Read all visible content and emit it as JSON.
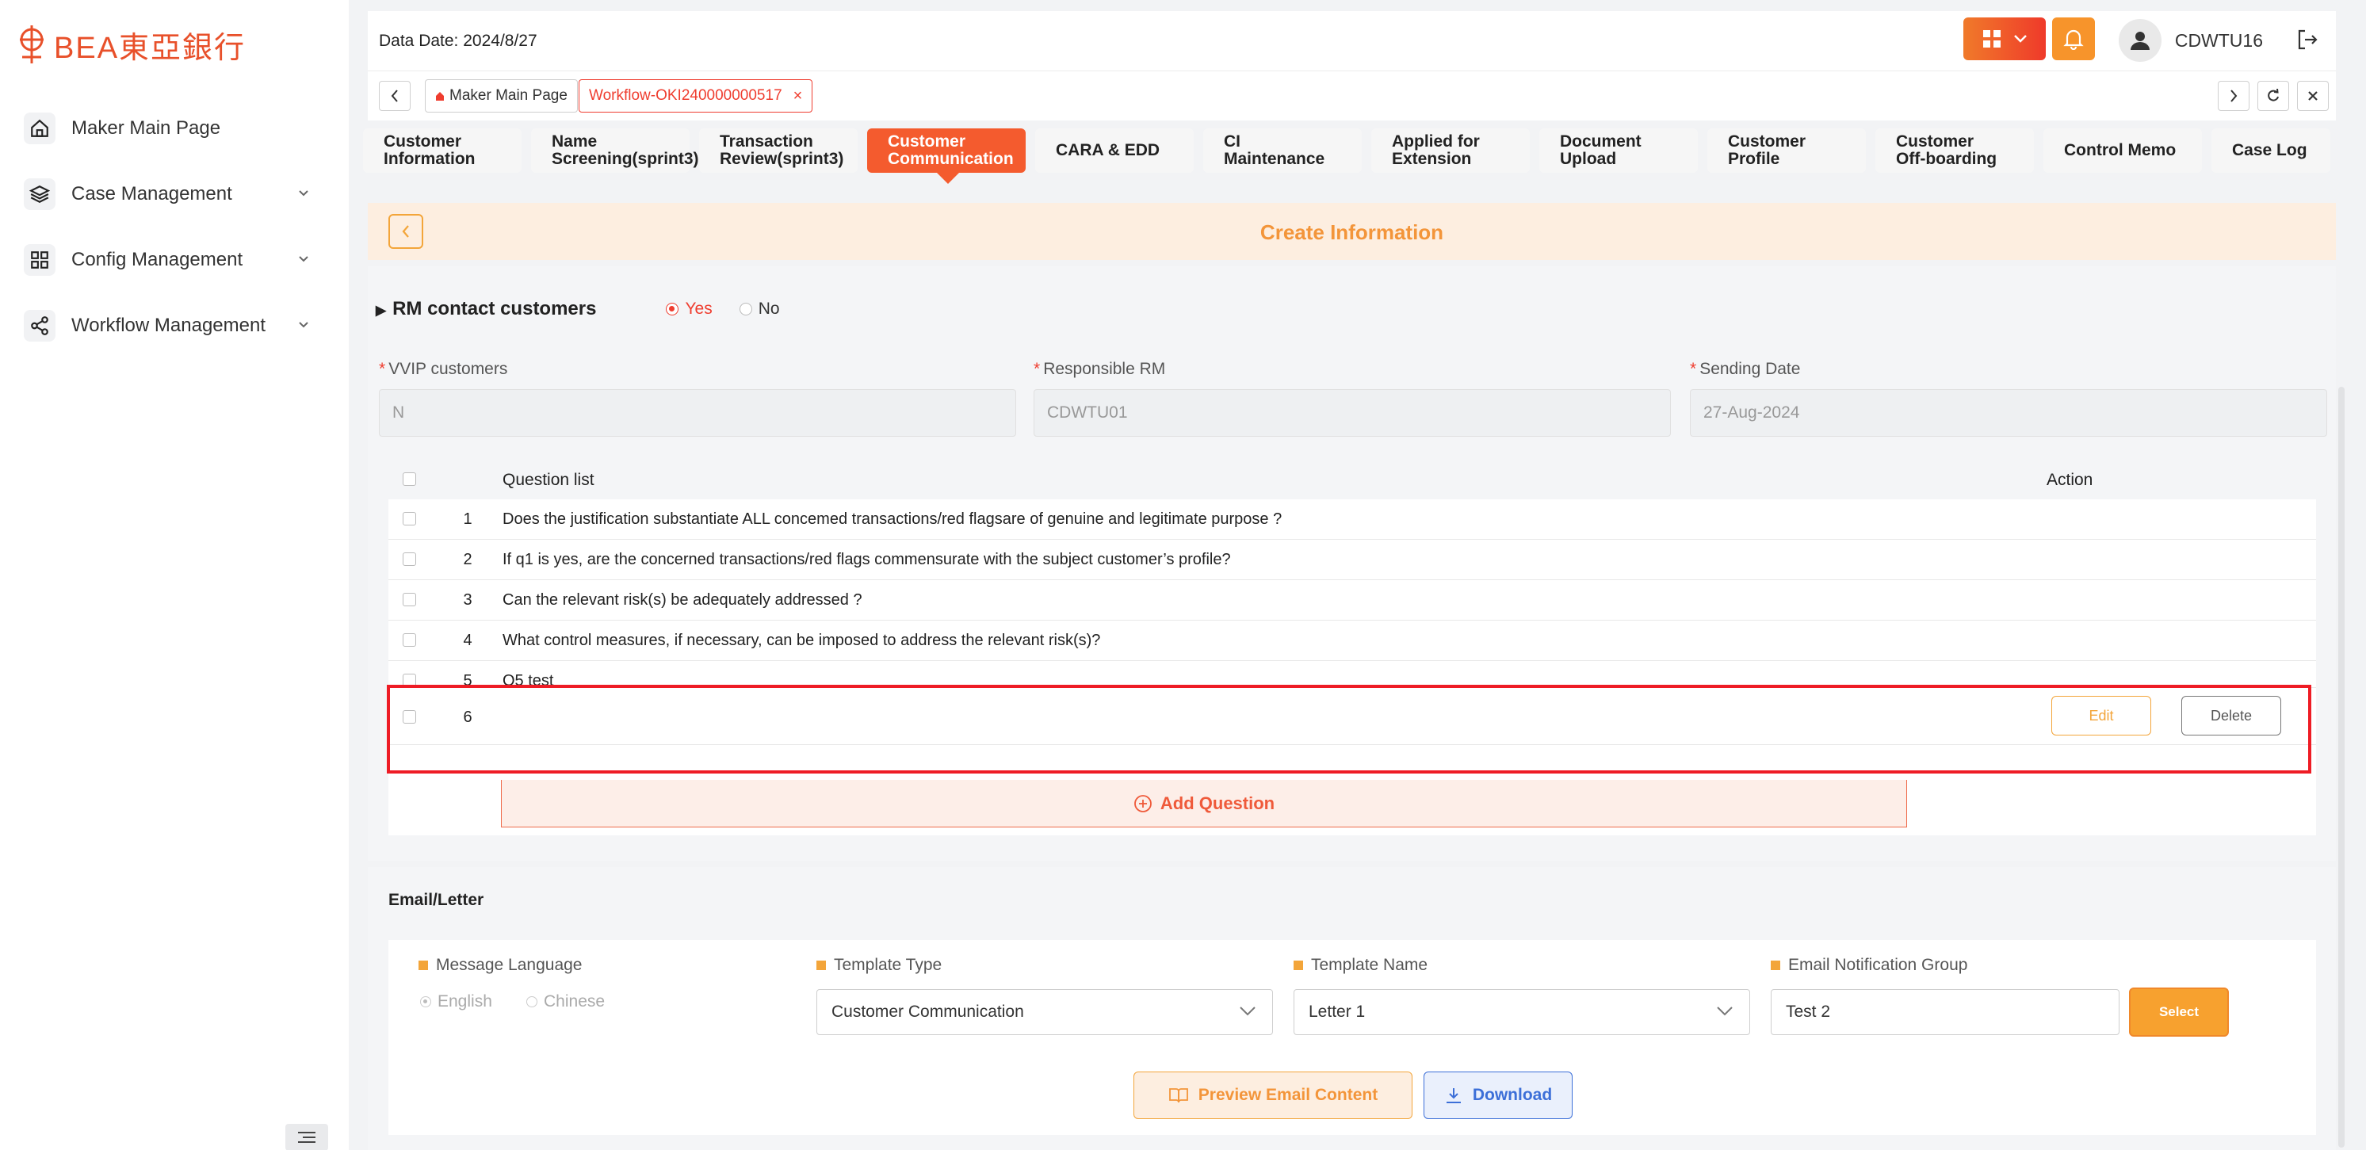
{
  "brand": {
    "name": "BEA東亞銀行",
    "accent": "#e8502a"
  },
  "sidebar": {
    "items": [
      {
        "label": "Maker Main Page",
        "icon": "home-icon",
        "has_chevron": false
      },
      {
        "label": "Case Management",
        "icon": "layers-icon",
        "has_chevron": true
      },
      {
        "label": "Config Management",
        "icon": "grid-icon",
        "has_chevron": true
      },
      {
        "label": "Workflow Management",
        "icon": "share-icon",
        "has_chevron": true
      }
    ]
  },
  "header": {
    "data_date_label": "Data Date:",
    "data_date_value": "2024/8/27",
    "username": "CDWTU16"
  },
  "tabstrip": {
    "tabs": [
      {
        "label": "Maker Main Page",
        "active": false
      },
      {
        "label": "Workflow-OKI240000000517",
        "active": true
      }
    ]
  },
  "workflow_tabs": [
    {
      "line1": "Customer",
      "line2": "Information",
      "active": false
    },
    {
      "line1": "Name",
      "line2": "Screening(sprint3)",
      "active": false
    },
    {
      "line1": "Transaction",
      "line2": "Review(sprint3)",
      "active": false
    },
    {
      "line1": "Customer",
      "line2": "Communication",
      "active": true
    },
    {
      "line1": "CARA & EDD",
      "line2": "",
      "active": false
    },
    {
      "line1": "CI",
      "line2": "Maintenance",
      "active": false
    },
    {
      "line1": "Applied for",
      "line2": "Extension",
      "active": false
    },
    {
      "line1": "Document",
      "line2": "Upload",
      "active": false
    },
    {
      "line1": "Customer Profile",
      "line2": "",
      "active": false
    },
    {
      "line1": "Customer",
      "line2": "Off-boarding",
      "active": false
    },
    {
      "line1": "Control Memo",
      "line2": "",
      "active": false
    },
    {
      "line1": "Case Log",
      "line2": "",
      "active": false
    }
  ],
  "create_info": {
    "title": "Create Information"
  },
  "rm_contact": {
    "label": "RM contact customers",
    "yes_label": "Yes",
    "no_label": "No",
    "selected": "Yes"
  },
  "fields": {
    "vvip": {
      "label": "VVIP customers",
      "value": "N"
    },
    "responsible_rm": {
      "label": "Responsible RM",
      "value": "CDWTU01"
    },
    "sending_date": {
      "label": "Sending Date",
      "value": "27-Aug-2024"
    }
  },
  "questions": {
    "header_label": "Question list",
    "action_label": "Action",
    "rows": [
      {
        "num": "1",
        "text": "Does the justification substantiate ALL concemed transactions/red flagsare of genuine and legitimate purpose ?"
      },
      {
        "num": "2",
        "text": "If q1 is yes, are the concerned transactions/red flags commensurate with the subject customer’s profile?"
      },
      {
        "num": "3",
        "text": "Can the relevant risk(s) be adequately addressed ?"
      },
      {
        "num": "4",
        "text": "What control measures, if necessary, can be imposed to address the relevant risk(s)?"
      },
      {
        "num": "5",
        "text": "Q5 test"
      },
      {
        "num": "6",
        "text": ""
      }
    ],
    "edit_label": "Edit",
    "delete_label": "Delete",
    "add_label": "Add Question"
  },
  "email": {
    "title": "Email/Letter",
    "language_label": "Message Language",
    "english_label": "English",
    "chinese_label": "Chinese",
    "template_type_label": "Template Type",
    "template_type_value": "Customer Communication",
    "template_name_label": "Template Name",
    "template_name_value": "Letter 1",
    "notification_group_label": "Email Notification Group",
    "notification_group_value": "Test 2",
    "select_label": "Select",
    "preview_label": "Preview Email Content",
    "download_label": "Download"
  }
}
